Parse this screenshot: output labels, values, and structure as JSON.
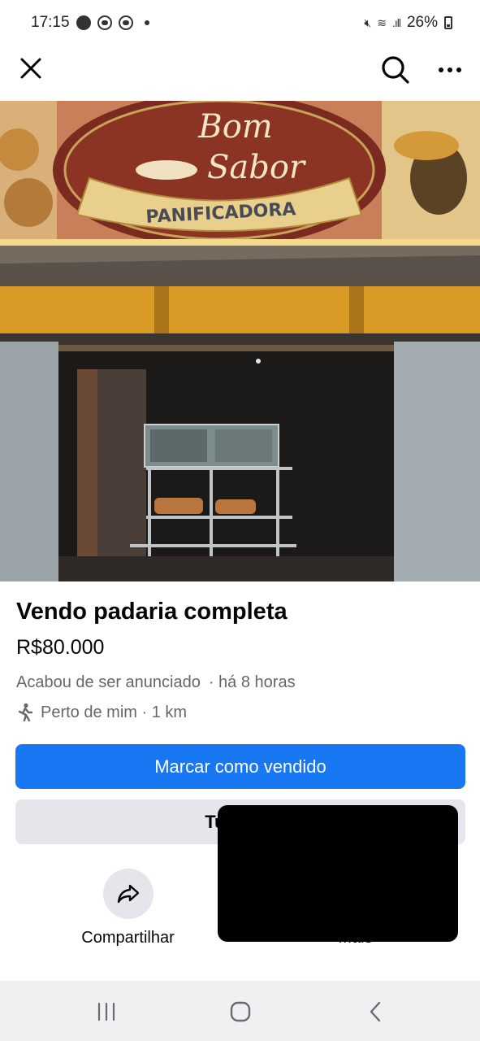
{
  "status_bar": {
    "time": "17:15",
    "battery": "26%"
  },
  "top_bar": {
    "close_icon": "close-icon",
    "search_icon": "search-icon",
    "more_icon": "more-horizontal-icon"
  },
  "photo": {
    "sign_line1": "Bom",
    "sign_line2": "Sabor",
    "sign_ribbon": "PANIFICADORA"
  },
  "listing": {
    "title": "Vendo padaria completa",
    "price": "R$80.000",
    "listed_status": "Acabou de ser anunciado",
    "listed_time": "· há 8 horas",
    "location": "Perto de mim · 1 km",
    "location_icon": "walking-person-icon"
  },
  "buttons": {
    "mark_sold": "Marcar como vendido",
    "boost": "Turbinar"
  },
  "actions": {
    "share_label": "Compartilhar",
    "share_icon": "share-arrow-icon",
    "more_label": "Mais"
  },
  "colors": {
    "primary": "#1877f2",
    "secondary_bg": "#e4e6eb",
    "muted_text": "#65676b"
  },
  "nav_bar": {
    "recent_icon": "recent-apps-icon",
    "home_icon": "home-icon",
    "back_icon": "back-icon"
  }
}
